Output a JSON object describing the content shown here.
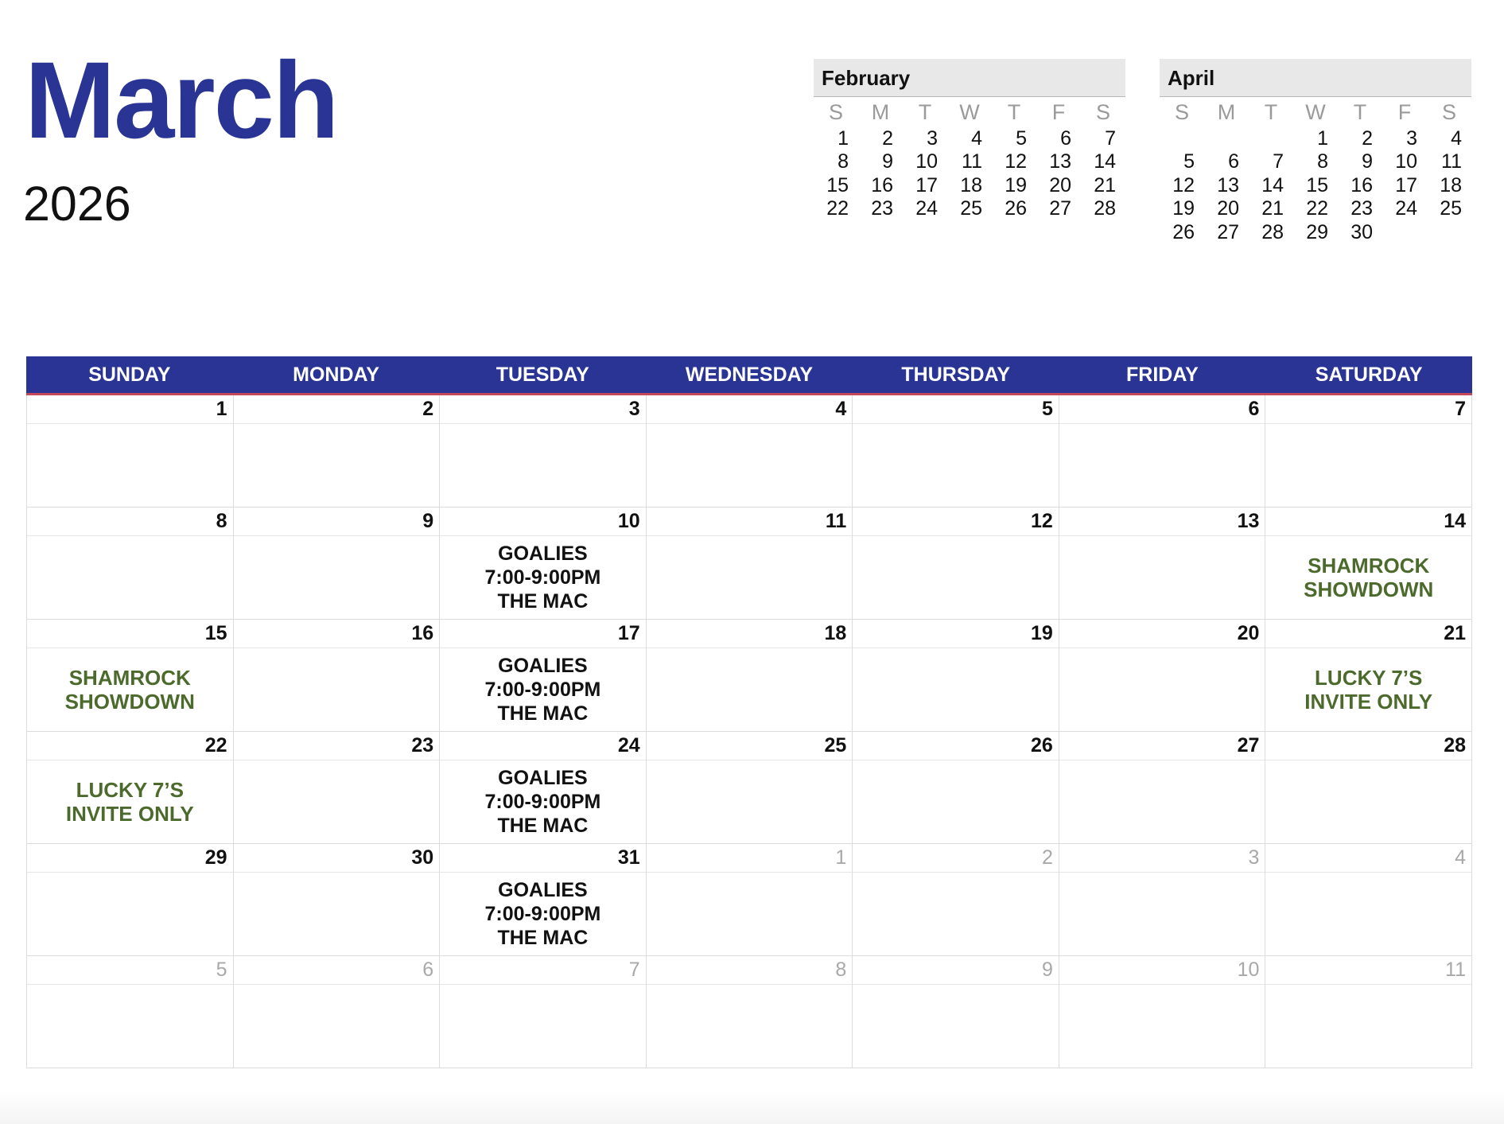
{
  "title": {
    "month": "March",
    "year": "2026"
  },
  "mini_calendars": [
    {
      "name": "February",
      "dow": [
        "S",
        "M",
        "T",
        "W",
        "T",
        "F",
        "S"
      ],
      "days": [
        "1",
        "2",
        "3",
        "4",
        "5",
        "6",
        "7",
        "8",
        "9",
        "10",
        "11",
        "12",
        "13",
        "14",
        "15",
        "16",
        "17",
        "18",
        "19",
        "20",
        "21",
        "22",
        "23",
        "24",
        "25",
        "26",
        "27",
        "28"
      ],
      "lead_blanks": 0
    },
    {
      "name": "April",
      "dow": [
        "S",
        "M",
        "T",
        "W",
        "T",
        "F",
        "S"
      ],
      "days": [
        "",
        "",
        "",
        "1",
        "2",
        "3",
        "4",
        "5",
        "6",
        "7",
        "8",
        "9",
        "10",
        "11",
        "12",
        "13",
        "14",
        "15",
        "16",
        "17",
        "18",
        "19",
        "20",
        "21",
        "22",
        "23",
        "24",
        "25",
        "26",
        "27",
        "28",
        "29",
        "30"
      ],
      "lead_blanks": 3
    }
  ],
  "main_calendar": {
    "weekdays": [
      "SUNDAY",
      "MONDAY",
      "TUESDAY",
      "WEDNESDAY",
      "THURSDAY",
      "FRIDAY",
      "SATURDAY"
    ],
    "weeks": [
      [
        {
          "day": "1"
        },
        {
          "day": "2"
        },
        {
          "day": "3"
        },
        {
          "day": "4"
        },
        {
          "day": "5"
        },
        {
          "day": "6"
        },
        {
          "day": "7"
        }
      ],
      [
        {
          "day": "8"
        },
        {
          "day": "9"
        },
        {
          "day": "10",
          "event": {
            "lines": [
              "GOALIES",
              "7:00-9:00PM",
              "THE MAC"
            ],
            "style": "dark"
          }
        },
        {
          "day": "11"
        },
        {
          "day": "12"
        },
        {
          "day": "13"
        },
        {
          "day": "14",
          "event": {
            "lines": [
              "SHAMROCK",
              "SHOWDOWN"
            ],
            "style": "green"
          }
        }
      ],
      [
        {
          "day": "15",
          "event": {
            "lines": [
              "SHAMROCK",
              "SHOWDOWN"
            ],
            "style": "green"
          }
        },
        {
          "day": "16"
        },
        {
          "day": "17",
          "event": {
            "lines": [
              "GOALIES",
              "7:00-9:00PM",
              "THE MAC"
            ],
            "style": "dark"
          }
        },
        {
          "day": "18"
        },
        {
          "day": "19"
        },
        {
          "day": "20"
        },
        {
          "day": "21",
          "event": {
            "lines": [
              "LUCKY 7’S",
              "INVITE ONLY"
            ],
            "style": "green"
          }
        }
      ],
      [
        {
          "day": "22",
          "event": {
            "lines": [
              "LUCKY 7’S",
              "INVITE ONLY"
            ],
            "style": "green"
          }
        },
        {
          "day": "23"
        },
        {
          "day": "24",
          "event": {
            "lines": [
              "GOALIES",
              "7:00-9:00PM",
              "THE MAC"
            ],
            "style": "dark"
          }
        },
        {
          "day": "25"
        },
        {
          "day": "26"
        },
        {
          "day": "27"
        },
        {
          "day": "28"
        }
      ],
      [
        {
          "day": "29"
        },
        {
          "day": "30"
        },
        {
          "day": "31",
          "event": {
            "lines": [
              "GOALIES",
              "7:00-9:00PM",
              "THE MAC"
            ],
            "style": "dark"
          }
        },
        {
          "day": "1",
          "other": true
        },
        {
          "day": "2",
          "other": true
        },
        {
          "day": "3",
          "other": true
        },
        {
          "day": "4",
          "other": true
        }
      ],
      [
        {
          "day": "5",
          "other": true
        },
        {
          "day": "6",
          "other": true
        },
        {
          "day": "7",
          "other": true
        },
        {
          "day": "8",
          "other": true
        },
        {
          "day": "9",
          "other": true
        },
        {
          "day": "10",
          "other": true
        },
        {
          "day": "11",
          "other": true
        }
      ]
    ]
  },
  "colors": {
    "accent": "#2a3494",
    "event_green": "#4c6a2c",
    "header_underline": "#c44a5a"
  }
}
